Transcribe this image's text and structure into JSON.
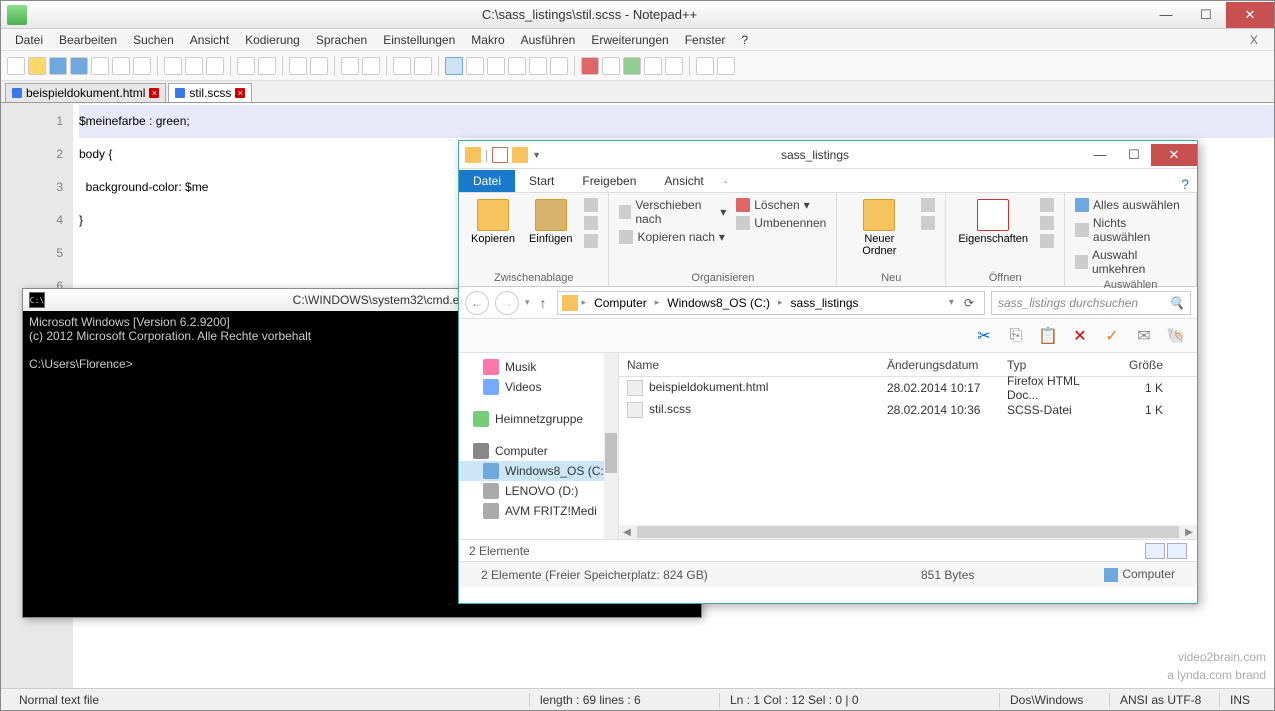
{
  "npp": {
    "title": "C:\\sass_listings\\stil.scss - Notepad++",
    "menu": [
      "Datei",
      "Bearbeiten",
      "Suchen",
      "Ansicht",
      "Kodierung",
      "Sprachen",
      "Einstellungen",
      "Makro",
      "Ausführen",
      "Erweiterungen",
      "Fenster",
      "?"
    ],
    "tabs": [
      {
        "label": "beispieldokument.html",
        "active": false
      },
      {
        "label": "stil.scss",
        "active": true
      }
    ],
    "gutter": [
      "1",
      "2",
      "3",
      "4",
      "5",
      "6"
    ],
    "code_line1": "$meinefarbe : green;",
    "code_line2": "",
    "code_line3": "body {",
    "code_line4": "  background-color: $me",
    "code_line5": "}",
    "status": {
      "left": "Normal text file",
      "len": "length : 69    lines : 6",
      "pos": "Ln : 1    Col : 12    Sel : 0 | 0",
      "eol": "Dos\\Windows",
      "enc": "ANSI as UTF-8",
      "ins": "INS"
    }
  },
  "cmd": {
    "title": "C:\\WINDOWS\\system32\\cmd.e",
    "line1": "Microsoft Windows [Version 6.2.9200]",
    "line2": "(c) 2012 Microsoft Corporation. Alle Rechte vorbehalt",
    "prompt": "C:\\Users\\Florence>"
  },
  "explorer": {
    "title": "sass_listings",
    "ribbon_tabs": {
      "file": "Datei",
      "start": "Start",
      "share": "Freigeben",
      "view": "Ansicht"
    },
    "ribbon": {
      "clipboard": {
        "label": "Zwischenablage",
        "copy": "Kopieren",
        "paste": "Einfügen"
      },
      "organize": {
        "label": "Organisieren",
        "move": "Verschieben nach",
        "copyto": "Kopieren nach",
        "delete": "Löschen",
        "rename": "Umbenennen"
      },
      "new": {
        "label": "Neu",
        "newfolder": "Neuer\nOrdner"
      },
      "open": {
        "label": "Öffnen",
        "props": "Eigenschaften"
      },
      "select": {
        "label": "Auswählen",
        "all": "Alles auswählen",
        "none": "Nichts auswählen",
        "invert": "Auswahl umkehren"
      }
    },
    "breadcrumb": [
      "Computer",
      "Windows8_OS (C:)",
      "sass_listings"
    ],
    "search_placeholder": "sass_listings durchsuchen",
    "nav": {
      "music": "Musik",
      "videos": "Videos",
      "homegroup": "Heimnetzgruppe",
      "computer": "Computer",
      "drive_c": "Windows8_OS (C:)",
      "drive_d": "LENOVO (D:)",
      "fritz": "AVM FRITZ!Medi"
    },
    "columns": {
      "name": "Name",
      "date": "Änderungsdatum",
      "type": "Typ",
      "size": "Größe"
    },
    "files": [
      {
        "name": "beispieldokument.html",
        "date": "28.02.2014 10:17",
        "type": "Firefox HTML Doc...",
        "size": "1 K"
      },
      {
        "name": "stil.scss",
        "date": "28.02.2014 10:36",
        "type": "SCSS-Datei",
        "size": "1 K"
      }
    ],
    "status1": "2 Elemente",
    "status2": {
      "left": "2 Elemente (Freier Speicherplatz: 824 GB)",
      "size": "851 Bytes",
      "loc": "Computer"
    }
  },
  "watermark": {
    "l1": "video2brain.com",
    "l2": "a lynda.com brand"
  }
}
